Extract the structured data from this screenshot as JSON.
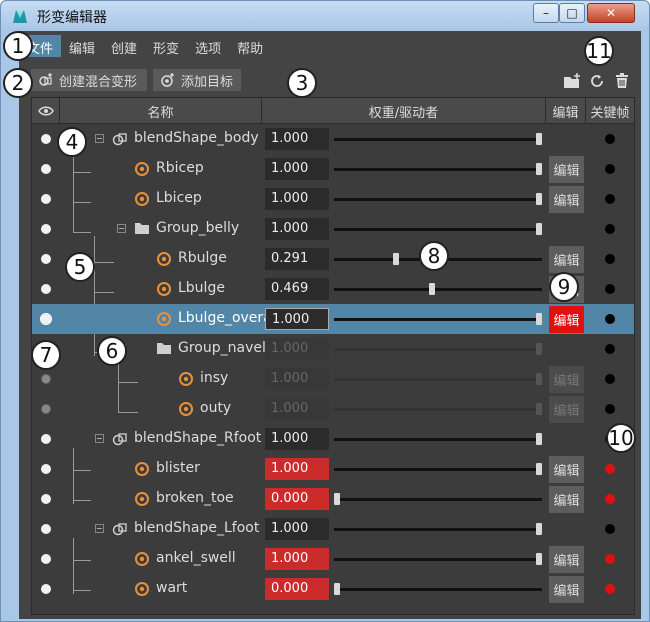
{
  "window": {
    "title": "形变编辑器",
    "min": "–",
    "max": "□",
    "close": "✕"
  },
  "menu": [
    "文件",
    "编辑",
    "创建",
    "形变",
    "选项",
    "帮助"
  ],
  "toolbar": {
    "create_blend": "创建混合变形",
    "add_target": "添加目标"
  },
  "header": {
    "name": "名称",
    "weight": "权重/驱动者",
    "edit": "编辑",
    "keyframe": "关键帧"
  },
  "rows": [
    {
      "name": "blendShape_body",
      "weight": "1.000",
      "slider": 1.0,
      "edit": "",
      "key": "black",
      "vis": "on"
    },
    {
      "name": "Rbicep",
      "weight": "1.000",
      "slider": 1.0,
      "edit": "编辑",
      "key": "black",
      "vis": "on"
    },
    {
      "name": "Lbicep",
      "weight": "1.000",
      "slider": 1.0,
      "edit": "编辑",
      "key": "black",
      "vis": "on"
    },
    {
      "name": "Group_belly",
      "weight": "1.000",
      "slider": 1.0,
      "edit": "",
      "key": "black",
      "vis": "on"
    },
    {
      "name": "Rbulge",
      "weight": "0.291",
      "slider": 0.291,
      "edit": "编辑",
      "key": "black",
      "vis": "on"
    },
    {
      "name": "Lbulge",
      "weight": "0.469",
      "slider": 0.469,
      "edit": "编辑",
      "key": "black",
      "vis": "on"
    },
    {
      "name": "Lbulge_overall",
      "weight": "1.000",
      "slider": 1.0,
      "edit": "编辑",
      "key": "black",
      "vis": "on"
    },
    {
      "name": "Group_navel",
      "weight": "1.000",
      "slider": 1.0,
      "edit": "",
      "key": "black",
      "vis": "on"
    },
    {
      "name": "insy",
      "weight": "1.000",
      "slider": 1.0,
      "edit": "编辑",
      "key": "black",
      "vis": "off"
    },
    {
      "name": "outy",
      "weight": "1.000",
      "slider": 1.0,
      "edit": "编辑",
      "key": "black",
      "vis": "off"
    },
    {
      "name": "blendShape_Rfoot",
      "weight": "1.000",
      "slider": 1.0,
      "edit": "",
      "key": "black",
      "vis": "on"
    },
    {
      "name": "blister",
      "weight": "1.000",
      "slider": 1.0,
      "edit": "编辑",
      "key": "red",
      "vis": "on"
    },
    {
      "name": "broken_toe",
      "weight": "0.000",
      "slider": 0.0,
      "edit": "编辑",
      "key": "red",
      "vis": "on"
    },
    {
      "name": "blendShape_Lfoot",
      "weight": "1.000",
      "slider": 1.0,
      "edit": "",
      "key": "black",
      "vis": "on"
    },
    {
      "name": "ankel_swell",
      "weight": "1.000",
      "slider": 1.0,
      "edit": "编辑",
      "key": "red",
      "vis": "on"
    },
    {
      "name": "wart",
      "weight": "0.000",
      "slider": 0.0,
      "edit": "编辑",
      "key": "red",
      "vis": "on"
    }
  ],
  "callouts": [
    "1",
    "2",
    "3",
    "4",
    "5",
    "6",
    "7",
    "8",
    "9",
    "10",
    "11"
  ],
  "colors": {
    "selection": "#5285a6",
    "edit_active": "#e11010",
    "key_red": "#e01010",
    "weight_red": "#cc2b2b"
  }
}
